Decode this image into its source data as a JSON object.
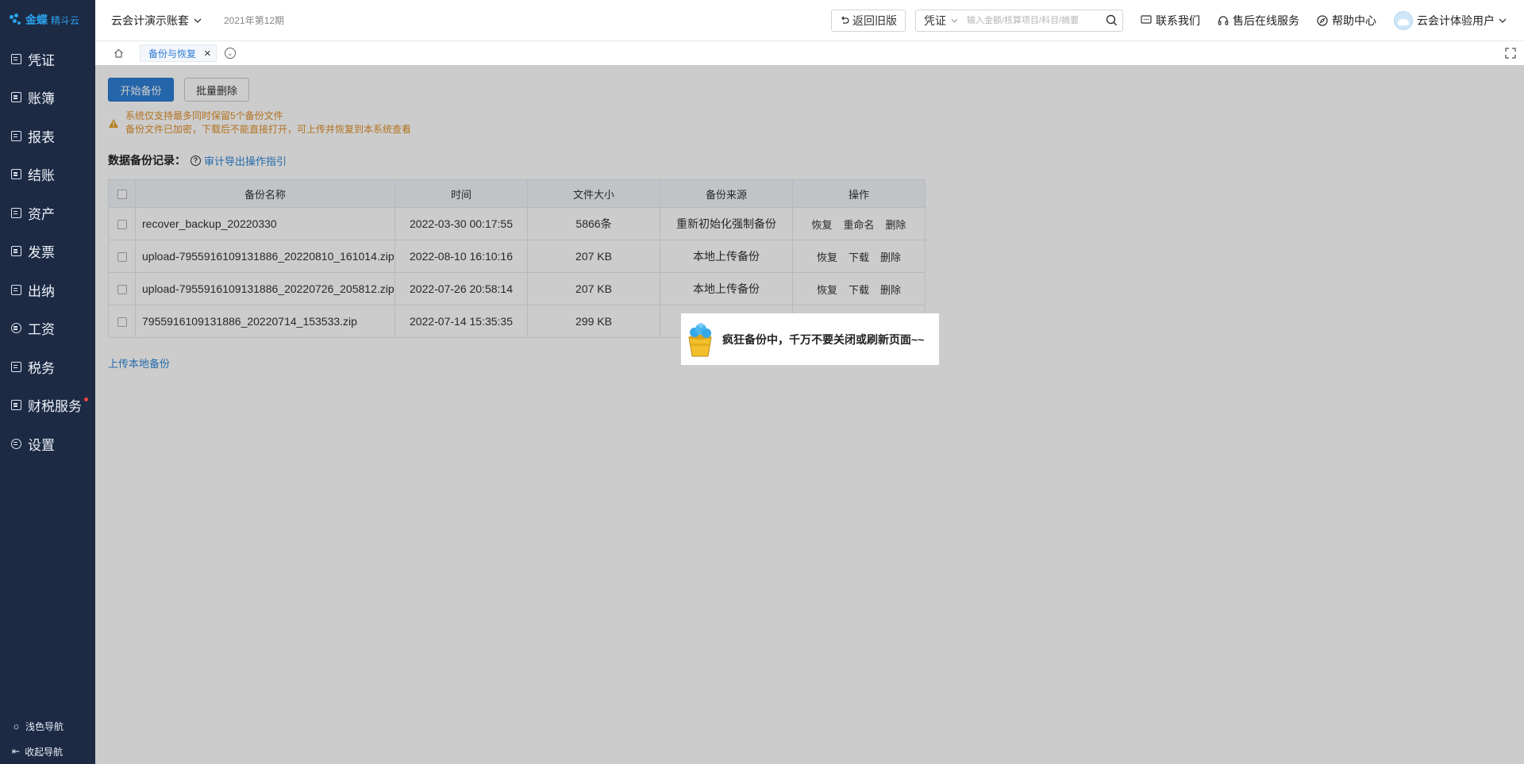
{
  "brand": {
    "logo": "金蝶",
    "sub": "精斗云"
  },
  "sidebar": {
    "items": [
      {
        "label": "凭证"
      },
      {
        "label": "账簿"
      },
      {
        "label": "报表"
      },
      {
        "label": "结账"
      },
      {
        "label": "资产"
      },
      {
        "label": "发票"
      },
      {
        "label": "出纳"
      },
      {
        "label": "工资"
      },
      {
        "label": "税务"
      },
      {
        "label": "财税服务"
      },
      {
        "label": "设置"
      }
    ],
    "bottom": [
      {
        "label": "浅色导航"
      },
      {
        "label": "收起导航"
      }
    ]
  },
  "header": {
    "account": "云会计演示账套",
    "period": "2021年第12期",
    "old_version": "返回旧版",
    "search_type": "凭证",
    "search_placeholder": "输入金额/核算项目/科目/摘要",
    "contact": "联系我们",
    "service": "售后在线服务",
    "help": "帮助中心",
    "user": "云会计体验用户"
  },
  "tabs": [
    {
      "label": "备份与恢复"
    }
  ],
  "toolbar": {
    "start_backup": "开始备份",
    "batch_delete": "批量删除"
  },
  "notice": {
    "line1": "系统仅支持最多同时保留5个备份文件",
    "line2": "备份文件已加密，下载后不能直接打开，可上传并恢复到本系统查看"
  },
  "records": {
    "title": "数据备份记录：",
    "guide": "审计导出操作指引"
  },
  "table": {
    "columns": [
      "备份名称",
      "时间",
      "文件大小",
      "备份来源",
      "操作"
    ],
    "rows": [
      {
        "name": "recover_backup_20220330",
        "time": "2022-03-30 00:17:55",
        "size": "5866条",
        "source": "重新初始化强制备份",
        "ops": [
          "恢复",
          "重命名",
          "删除"
        ]
      },
      {
        "name": "upload-7955916109131886_20220810_161014.zip",
        "time": "2022-08-10 16:10:16",
        "size": "207 KB",
        "source": "本地上传备份",
        "ops": [
          "恢复",
          "下载",
          "删除"
        ]
      },
      {
        "name": "upload-7955916109131886_20220726_205812.zip",
        "time": "2022-07-26 20:58:14",
        "size": "207 KB",
        "source": "本地上传备份",
        "ops": [
          "恢复",
          "下载",
          "删除"
        ]
      },
      {
        "name": "7955916109131886_20220714_153533.zip",
        "time": "2022-07-14 15:35:35",
        "size": "299 KB",
        "source": "",
        "ops": []
      }
    ]
  },
  "upload_local": "上传本地备份",
  "toast": {
    "message": "疯狂备份中，千万不要关闭或刷新页面~~"
  },
  "colors": {
    "sidebar": "#1c2a44",
    "primary": "#2f80d5",
    "warning": "#e0902a",
    "link": "#2e86d6"
  },
  "icons": [
    "home-icon",
    "close-icon",
    "chevron-down-icon",
    "search-icon",
    "chat-icon",
    "headset-icon",
    "compass-icon",
    "fullscreen-icon",
    "warning-icon",
    "help-circle-icon",
    "bucket-icon"
  ]
}
